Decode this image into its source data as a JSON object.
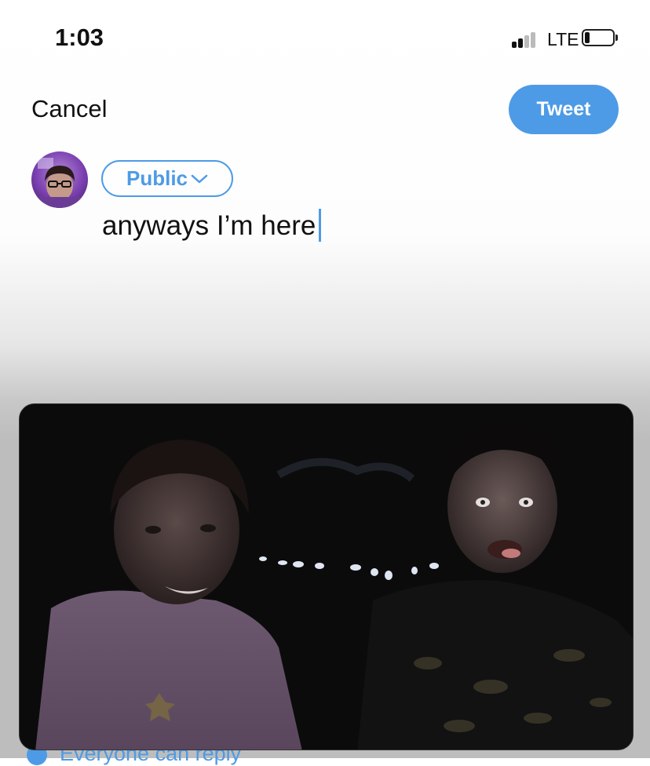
{
  "status_bar": {
    "time": "1:03",
    "network": "LTE",
    "signal_bars_filled": 2,
    "signal_bars_total": 4,
    "battery_level": 0.15
  },
  "header": {
    "cancel_label": "Cancel",
    "tweet_label": "Tweet"
  },
  "composer": {
    "audience_label": "Public",
    "text": "anyways I’m here"
  },
  "footer": {
    "reply_setting_label": "Everyone can reply"
  },
  "colors": {
    "accent": "#4d9be6",
    "text": "#111111"
  },
  "icons": [
    "signal-icon",
    "battery-icon",
    "chevron-down-icon",
    "globe-icon"
  ]
}
